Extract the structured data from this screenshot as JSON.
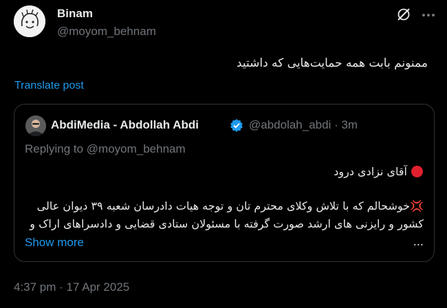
{
  "post": {
    "author_name": "Binam",
    "author_handle": "@moyom_behnam",
    "text": "ممنونم بابت همه حمایت‌هایی که داشتید",
    "translate_label": "Translate post",
    "timestamp": "4:37 pm · 17 Apr 2025"
  },
  "quote": {
    "author_name": "AbdiMedia - Abdollah Abdi",
    "author_handle": "@abdolah_abdi · 3m",
    "replying_to": "Replying to @moyom_behnam",
    "line1": "آقای نزادی درود",
    "body_line1": "خوشحالم که با تلاش وکلای محترم تان و توجه هیات دادرسان شعبه ۳۹ دیوان عالی",
    "body_line2": "کشور و رایزنی های ارشد صورت گرفته با مسئولان ستادی قضایی و دادسراهای اراک و ...",
    "show_more_label": "Show more"
  },
  "colors": {
    "accent": "#1d9bf0",
    "muted": "#71767b",
    "text": "#e7e9ea",
    "background": "#000000",
    "red": "#e0202f"
  },
  "icons": [
    "avatar-sketch",
    "grok-icon",
    "more-icon",
    "verified-badge-icon",
    "red-circle-icon",
    "anger-icon"
  ]
}
